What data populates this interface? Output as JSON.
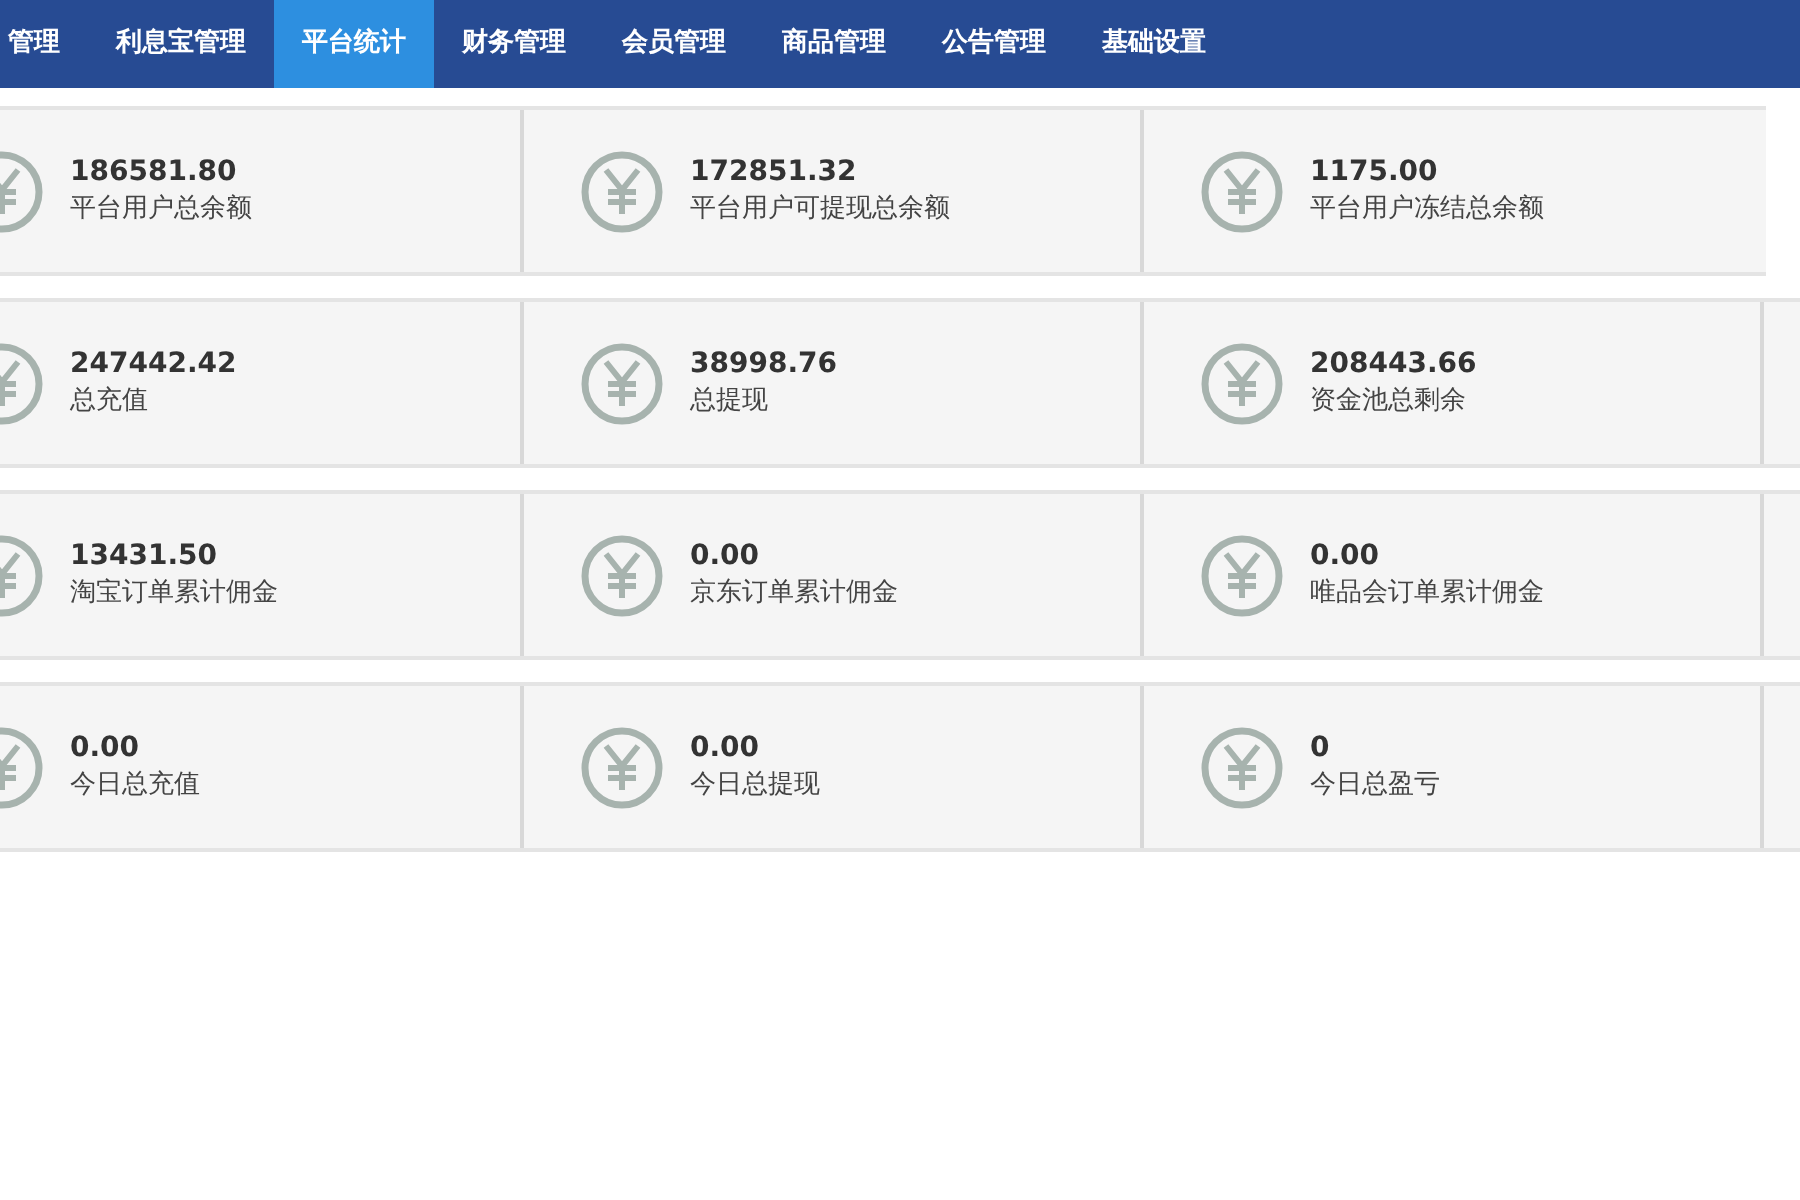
{
  "nav": [
    {
      "label": "管理",
      "selected": false
    },
    {
      "label": "利息宝管理",
      "selected": false
    },
    {
      "label": "平台统计",
      "selected": true
    },
    {
      "label": "财务管理",
      "selected": false
    },
    {
      "label": "会员管理",
      "selected": false
    },
    {
      "label": "商品管理",
      "selected": false
    },
    {
      "label": "公告管理",
      "selected": false
    },
    {
      "label": "基础设置",
      "selected": false
    }
  ],
  "stat_rows": [
    {
      "continues_right": false,
      "stats": [
        {
          "value": "186581.80",
          "label": "平台用户总余额"
        },
        {
          "value": "172851.32",
          "label": "平台用户可提现总余额"
        },
        {
          "value": "1175.00",
          "label": "平台用户冻结总余额"
        }
      ]
    },
    {
      "continues_right": true,
      "stats": [
        {
          "value": "247442.42",
          "label": "总充值"
        },
        {
          "value": "38998.76",
          "label": "总提现"
        },
        {
          "value": "208443.66",
          "label": "资金池总剩余"
        }
      ]
    },
    {
      "continues_right": true,
      "stats": [
        {
          "value": "13431.50",
          "label": "淘宝订单累计佣金"
        },
        {
          "value": "0.00",
          "label": "京东订单累计佣金"
        },
        {
          "value": "0.00",
          "label": "唯品会订单累计佣金"
        }
      ]
    },
    {
      "continues_right": true,
      "stats": [
        {
          "value": "0.00",
          "label": "今日总充值"
        },
        {
          "value": "0.00",
          "label": "今日总提现"
        },
        {
          "value": "0",
          "label": "今日总盈亏"
        }
      ]
    }
  ]
}
